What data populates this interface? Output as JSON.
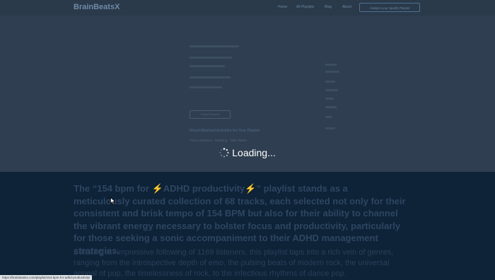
{
  "nav": {
    "brand": "BrainBeatsX",
    "links": [
      "Home",
      "All Playlists",
      "Blog",
      "About"
    ],
    "cta": "Analyze your Spotify Playlist"
  },
  "hero": {
    "button_label": "Submit Search",
    "heading": "Mood-Matched Activities for Your Playlist",
    "subline": "Focus Sessions · Studying · Task Starter"
  },
  "overlay": {
    "loading_text": "Loading..."
  },
  "article": {
    "lead": "The “154 bpm for ⚡ADHD productivity⚡” playlist stands as a meticulously curated collection of 68 tracks, each selected not only for their consistent and brisk tempo of 154 BPM but also for their ability to channel the vibrant energy necessary to bolster focus and productivity, particularly for those seeking a sonic accompaniment to their ADHD management strategies.",
    "body": "Boasting an impressive following of 1169 listeners, this playlist taps into a rich vein of genres, ranging from the introspective depth of emo, the pulsing beats of modern rock, the universal appeal of pop, the timelessness of rock, to the infectious rhythms of dance pop."
  },
  "status_bar": {
    "url": "https://brainbeatsx.com/playlist/154-bpm-for-adhd-productivity/"
  }
}
